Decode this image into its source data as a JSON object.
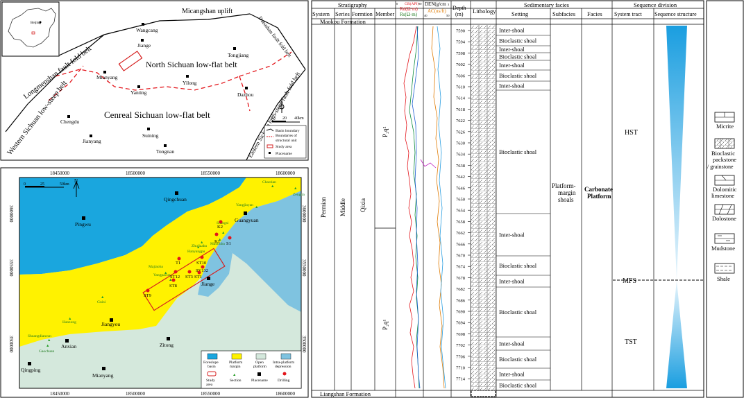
{
  "colors": {
    "foreslope": "#1aa6de",
    "margin": "#fff200",
    "open": "#d4e8dc",
    "depression": "#7fc3e0",
    "section": "#2a9e2a",
    "drilling": "#e3151b",
    "boundary": "#e3151b",
    "study": "#d62020"
  },
  "top_map": {
    "regions": {
      "micangshan": "Micangshan uplift",
      "dabashan": "Dabashan fault fold belt",
      "longmenshan": "Longmenshan fault fold belt",
      "north_sichuan": "North Sichuan low-flat belt",
      "western_sichuan": "Western Sichuan low-steep belt",
      "central_sichuan": "Cenreal Sichuan low-flat belt",
      "eastern_sichuan": "Eastern Sichuan high-steep fault fold belt"
    },
    "places": {
      "wangcang": "Wangcang",
      "jiange": "Jiange",
      "tongjiang": "Tongjiang",
      "mianyang": "Mianyang",
      "yilong": "Yilong",
      "yanting": "Yanting",
      "dazhou": "Dazhou",
      "chengdu": "Chengdu",
      "suining": "Suining",
      "jianyang": "Jianyang",
      "tongnan": "Tongnan"
    },
    "inset_label": "Beijing",
    "scale": {
      "s0": "0",
      "s1": "20",
      "s2": "40km"
    },
    "north": "N",
    "legend": [
      "Basin boundary",
      "Boundaries of",
      "structural unit",
      "Study area",
      "Placename"
    ]
  },
  "bottom_map": {
    "x_ticks": [
      "18450000",
      "18500000",
      "18550000",
      "18600000"
    ],
    "y_ticks": [
      "3600000",
      "3550000",
      "3500000"
    ],
    "scale": {
      "s0": "0",
      "s1": "25",
      "s2": "50km"
    },
    "north": "N",
    "places": {
      "qingchuan": "Qingchuan",
      "pingwu": "Pingwu",
      "guangyuan": "Guangyuan",
      "jiange": "Jiange",
      "jiangyou": "Jiangyou",
      "anxian": "Anxian",
      "zitong": "Zitong",
      "qingping": "Qingping",
      "mianyang": "Mianyang"
    },
    "sections": {
      "chaotian": "Chaotian",
      "zengjia": "Zengjia",
      "yangjiayan": "Yangjiayan",
      "shangsi": "Shangsi",
      "maobuba": "Maobuba",
      "zhujiaaba": "Zhujiaaba",
      "hanyangpu": "Hanyangpu",
      "majiaoba": "Majiaoba",
      "yangpacun": "Yangpacun",
      "guixi": "Guixi",
      "huangtong": "Hanzong",
      "shuangdiancun": "Shuangdiancun",
      "gaochuan": "Gaochuan"
    },
    "wells": {
      "k2": "K2",
      "k1": "K1",
      "s1": "S1",
      "t1": "T1",
      "st10": "ST10",
      "sy132": "SY132",
      "st12": "ST12",
      "st3": "ST3",
      "st1": "ST1",
      "st8": "ST8",
      "st9": "ST9"
    },
    "legend": {
      "foreslope_a": "Foreslope",
      "foreslope_b": "basin",
      "margin_a": "Platform",
      "margin_b": "margin",
      "open_a": "Open",
      "open_b": "platform",
      "dep_a": "Intra-platform",
      "dep_b": "depression",
      "study_a": "Study",
      "study_b": "area",
      "section": "Section",
      "placename": "Placename",
      "drilling": "Drilling"
    }
  },
  "column": {
    "top_formation": "Maokou Formation",
    "bottom_formation": "Liangshan Formation",
    "headers": {
      "stratigraphy": "Stratigraphy",
      "system": "System",
      "series": "Series",
      "formation": "Formtion",
      "member": "Member",
      "gr": "GR(API)",
      "rd": "Rd(Ω·m)",
      "rs": "Rs(Ω·m)",
      "den": "DEN(g/cm",
      "ac": "AC(us/ft)",
      "depth_a": "Depth",
      "depth_b": "(m)",
      "lithology": "Lithology",
      "sed": "Sedimentary facies",
      "setting": "Setting",
      "subfacies": "Subfacies",
      "facies": "Facies",
      "seq": "Sequence division",
      "tract": "System tract",
      "structure": "Sequence structure"
    },
    "log_scale": {
      "gr0": "0",
      "gr1": "90",
      "den1": "3",
      "ac0": "40",
      "ac1": "50"
    },
    "strat": {
      "system": "Permian",
      "series": "Middle",
      "formation": "Qixia",
      "member_upper": "P₂q²",
      "member_lower": "P₂q¹"
    },
    "depths": [
      "7590",
      "7594",
      "7598",
      "7602",
      "7606",
      "7610",
      "7614",
      "7618",
      "7622",
      "7626",
      "7630",
      "7634",
      "7638",
      "7642",
      "7646",
      "7650",
      "7654",
      "7658",
      "7662",
      "7666",
      "7670",
      "7674",
      "7678",
      "7682",
      "7686",
      "7690",
      "7694",
      "7698",
      "7702",
      "7706",
      "7710",
      "7714"
    ],
    "settings": [
      "Inter-shoal",
      "Bioclastic shoal",
      "Inter-shoal",
      "Bioclastic shoal",
      "Inter-shoal",
      "Bioclastic shoal",
      "Inter-shoal",
      "Bioclastic shoal",
      "Inter-shoal",
      "Bioclastic shoal",
      "Inter-shoal",
      "Bioclastic shoal",
      "Inter-shoal",
      "Bioclastic shoal",
      "Inter-shoal",
      "Bioclastic shoal"
    ],
    "subfacies_a": "Platform-",
    "subfacies_b": "margin",
    "subfacies_c": "shoals",
    "facies_a": "Carbonate",
    "facies_b": "Platform",
    "tracts": {
      "hst": "HST",
      "mfs": "MFS",
      "tst": "TST"
    }
  },
  "lith_legend": [
    "Micrite",
    "Bioclastic",
    "packstone",
    "/ grainstone",
    "Dolomitic",
    "limestone",
    "Dolostone",
    "Mudstone",
    "Shale"
  ]
}
